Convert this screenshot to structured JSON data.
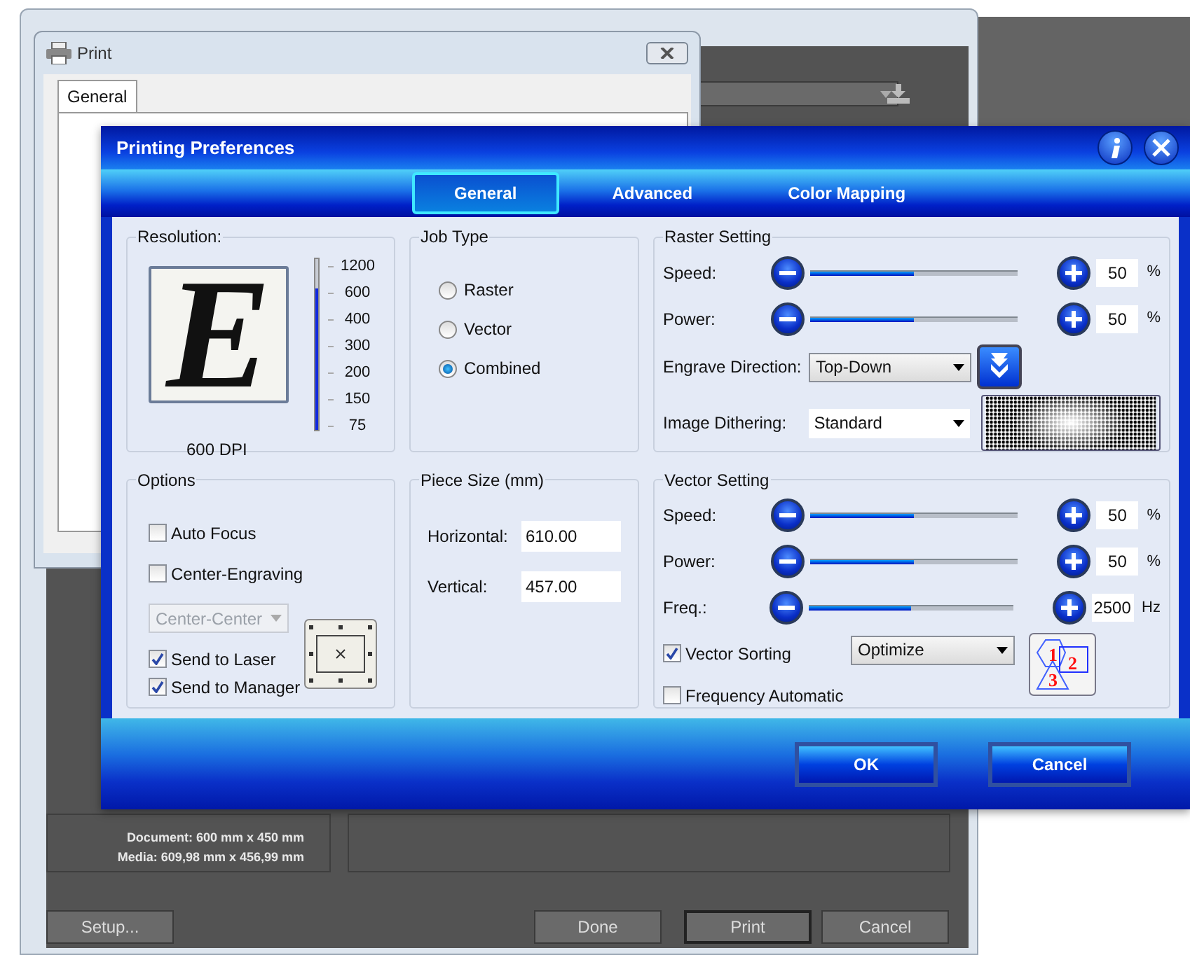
{
  "back_window": {
    "document_info": "Document: 600 mm x 450 mm",
    "media_info": "Media: 609,98 mm x 456,99 mm",
    "buttons": [
      {
        "label": "Setup...",
        "kind": "left"
      },
      {
        "label": "Done",
        "kind": "right"
      },
      {
        "label": "Print",
        "kind": "default"
      },
      {
        "label": "Cancel",
        "kind": "right"
      }
    ]
  },
  "print_dialog": {
    "title": "Print",
    "tabs": [
      {
        "label": "General",
        "selected": true
      }
    ]
  },
  "preferences": {
    "title": "Printing Preferences",
    "tabs": [
      {
        "label": "General",
        "selected": true
      },
      {
        "label": "Advanced",
        "selected": false
      },
      {
        "label": "Color Mapping",
        "selected": false
      }
    ],
    "resolution": {
      "title": "Resolution:",
      "preview_letter": "E",
      "dpi_label": "600 DPI",
      "scale": [
        "1200",
        "600",
        "400",
        "300",
        "200",
        "150",
        "75"
      ],
      "level": 0.83
    },
    "job_type": {
      "title": "Job Type",
      "options": [
        {
          "label": "Raster",
          "selected": false
        },
        {
          "label": "Vector",
          "selected": false
        },
        {
          "label": "Combined",
          "selected": true
        }
      ]
    },
    "raster": {
      "title": "Raster Setting",
      "sliders": [
        {
          "label": "Speed:",
          "value": "50",
          "unit": "%",
          "level": 0.5
        },
        {
          "label": "Power:",
          "value": "50",
          "unit": "%",
          "level": 0.5
        }
      ],
      "engrave_direction": {
        "label": "Engrave Direction:",
        "value": "Top-Down"
      },
      "image_dithering": {
        "label": "Image Dithering:",
        "value": "Standard"
      }
    },
    "options": {
      "title": "Options",
      "items": [
        {
          "kind": "checkbox",
          "label": "Auto Focus",
          "checked": false
        },
        {
          "kind": "checkbox",
          "label": "Center-Engraving",
          "checked": false
        },
        {
          "kind": "select",
          "value": "Center-Center",
          "disabled": true
        },
        {
          "kind": "checkbox",
          "label": "Send to Laser",
          "checked": true
        },
        {
          "kind": "checkbox",
          "label": "Send to Manager",
          "checked": true
        }
      ]
    },
    "piece_size": {
      "title": "Piece Size (mm)",
      "fields": [
        {
          "label": "Horizontal:",
          "value": "610.00"
        },
        {
          "label": "Vertical:",
          "value": "457.00"
        }
      ]
    },
    "vector": {
      "title": "Vector Setting",
      "sliders": [
        {
          "label": "Speed:",
          "value": "50",
          "unit": "%",
          "level": 0.5
        },
        {
          "label": "Power:",
          "value": "50",
          "unit": "%",
          "level": 0.5
        },
        {
          "label": "Freq.:",
          "value": "2500",
          "unit": "Hz",
          "level": 0.5
        }
      ],
      "checkboxes": [
        {
          "label": "Vector Sorting",
          "checked": true
        },
        {
          "label": "Frequency Automatic",
          "checked": false
        }
      ],
      "sorting": {
        "value": "Optimize"
      },
      "sort_marks": [
        "1",
        "2",
        "3"
      ]
    },
    "buttons": [
      "OK",
      "Cancel"
    ]
  }
}
